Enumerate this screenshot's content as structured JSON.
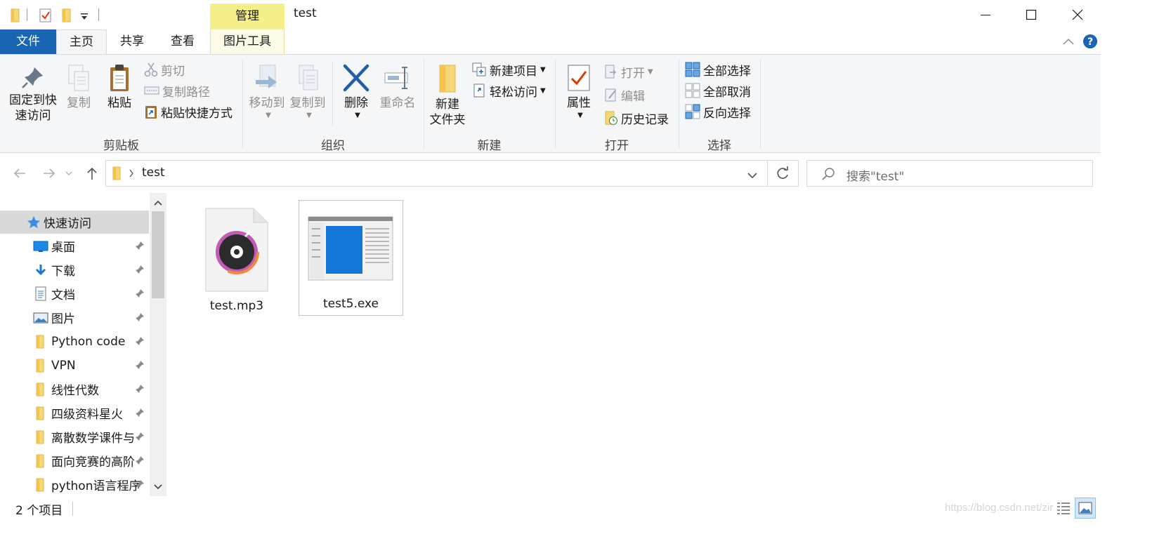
{
  "window": {
    "title": "test",
    "context_tab_header": "管理"
  },
  "ribbon_tabs": {
    "file": "文件",
    "home": "主页",
    "share": "共享",
    "view": "查看",
    "picture_tools": "图片工具"
  },
  "ribbon": {
    "clipboard": {
      "label": "剪贴板",
      "pin_quick_access_line1": "固定到快",
      "pin_quick_access_line2": "速访问",
      "copy": "复制",
      "paste": "粘贴",
      "cut": "剪切",
      "copy_path": "复制路径",
      "paste_shortcut": "粘贴快捷方式"
    },
    "organize": {
      "label": "组织",
      "move_to": "移动到",
      "copy_to": "复制到",
      "delete": "删除",
      "rename": "重命名"
    },
    "new": {
      "label": "新建",
      "new_folder_line1": "新建",
      "new_folder_line2": "文件夹",
      "new_item": "新建项目",
      "easy_access": "轻松访问"
    },
    "open": {
      "label": "打开",
      "properties": "属性",
      "open": "打开",
      "edit": "编辑",
      "history": "历史记录"
    },
    "select": {
      "label": "选择",
      "select_all": "全部选择",
      "select_none": "全部取消",
      "invert_selection": "反向选择"
    }
  },
  "address": {
    "path": "test",
    "search_placeholder": "搜索\"test\""
  },
  "nav_pane": {
    "quick_access": "快速访问",
    "items": [
      {
        "label": "桌面",
        "icon": "desktop-icon"
      },
      {
        "label": "下载",
        "icon": "download-icon"
      },
      {
        "label": "文档",
        "icon": "document-icon"
      },
      {
        "label": "图片",
        "icon": "picture-icon"
      },
      {
        "label": "Python code",
        "icon": "folder-icon"
      },
      {
        "label": "VPN",
        "icon": "folder-icon"
      },
      {
        "label": "线性代数",
        "icon": "folder-icon"
      },
      {
        "label": "四级资料星火",
        "icon": "folder-icon"
      },
      {
        "label": "离散数学课件与",
        "icon": "folder-icon"
      },
      {
        "label": "面向竞赛的高阶",
        "icon": "folder-icon"
      },
      {
        "label": "python语言程序",
        "icon": "folder-icon"
      }
    ]
  },
  "files": [
    {
      "name": "test.mp3",
      "icon": "mp3-file-icon",
      "selected": false
    },
    {
      "name": "test5.exe",
      "icon": "exe-file-icon",
      "selected": true
    }
  ],
  "status": {
    "item_count": "2 个项目",
    "watermark": "https://blog.csdn.net/zir"
  },
  "colors": {
    "file_tab": "#1a64b4",
    "context_tab": "#f5f089",
    "selection_border": "#99d1ff",
    "folder": "#f8d775"
  }
}
